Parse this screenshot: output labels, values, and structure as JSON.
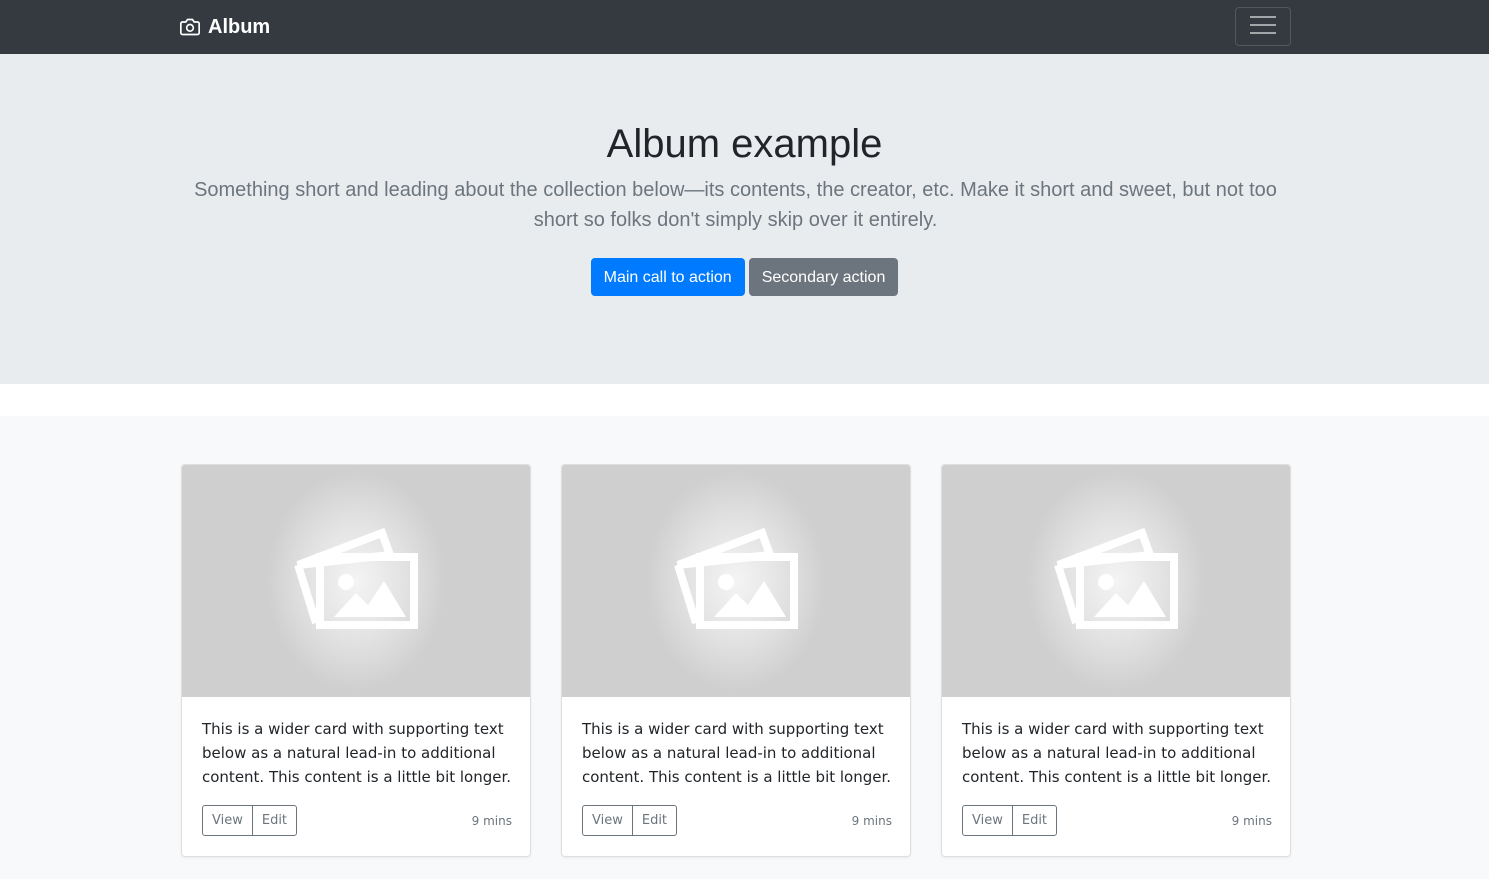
{
  "navbar": {
    "brand": "Album",
    "brand_icon": "camera-icon",
    "toggler_icon": "hamburger-icon",
    "background": "#343a40"
  },
  "jumbotron": {
    "heading": "Album example",
    "lead": "Something short and leading about the collection below—its contents, the creator, etc. Make it short and sweet, but not too short so folks don't simply skip over it entirely.",
    "primary_button": "Main call to action",
    "secondary_button": "Secondary action",
    "primary_color": "#007bff",
    "secondary_color": "#6c757d"
  },
  "cards": [
    {
      "image_icon": "image-placeholder-icon",
      "text": "This is a wider card with supporting text below as a natural lead-in to additional content. This content is a little bit longer.",
      "view_label": "View",
      "edit_label": "Edit",
      "time": "9 mins"
    },
    {
      "image_icon": "image-placeholder-icon",
      "text": "This is a wider card with supporting text below as a natural lead-in to additional content. This content is a little bit longer.",
      "view_label": "View",
      "edit_label": "Edit",
      "time": "9 mins"
    },
    {
      "image_icon": "image-placeholder-icon",
      "text": "This is a wider card with supporting text below as a natural lead-in to additional content. This content is a little bit longer.",
      "view_label": "View",
      "edit_label": "Edit",
      "time": "9 mins"
    }
  ]
}
